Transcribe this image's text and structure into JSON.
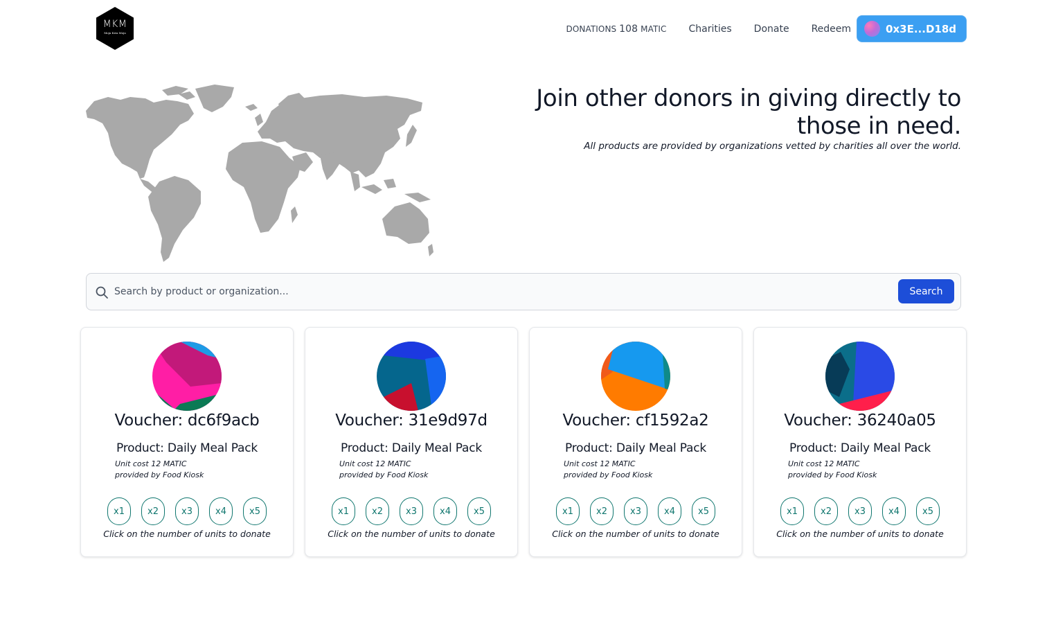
{
  "logo": {
    "letters": "MKM",
    "subtitle": "Moja Kwa Moja"
  },
  "nav": {
    "donations_label": "DONATIONS",
    "donations_value": "108",
    "donations_unit": "MATIC",
    "links": [
      "Charities",
      "Donate",
      "Redeem"
    ],
    "wallet_address": "0x3E...D18d"
  },
  "hero": {
    "title_line1": "Join other donors in giving directly to",
    "title_line2": "those in need.",
    "subtitle": "All products are provided by organizations vetted by charities all over the world."
  },
  "search": {
    "placeholder": "Search by product or organization...",
    "button_label": "Search"
  },
  "cards": [
    {
      "voucher": "Voucher: dc6f9acb",
      "product": "Product: Daily Meal Pack",
      "unit_cost": "Unit cost 12 MATIC",
      "provider": "provided by Food Kiosk",
      "units": [
        "x1",
        "x2",
        "x3",
        "x4",
        "x5"
      ],
      "hint": "Click on the number of units to donate",
      "colors": [
        "#ff1ea5",
        "#c2197a",
        "#1d9be6",
        "#0b7a55"
      ]
    },
    {
      "voucher": "Voucher: 31e9d97d",
      "product": "Product: Daily Meal Pack",
      "unit_cost": "Unit cost 12 MATIC",
      "provider": "provided by Food Kiosk",
      "units": [
        "x1",
        "x2",
        "x3",
        "x4",
        "x5"
      ],
      "hint": "Click on the number of units to donate",
      "colors": [
        "#05668d",
        "#1c39e0",
        "#1565f0",
        "#c8102e"
      ]
    },
    {
      "voucher": "Voucher: cf1592a2",
      "product": "Product: Daily Meal Pack",
      "unit_cost": "Unit cost 12 MATIC",
      "provider": "provided by Food Kiosk",
      "units": [
        "x1",
        "x2",
        "x3",
        "x4",
        "x5"
      ],
      "hint": "Click on the number of units to donate",
      "colors": [
        "#ff7b00",
        "#1699ef",
        "#f05a1a",
        "#0f8a8a"
      ]
    },
    {
      "voucher": "Voucher: 36240a05",
      "product": "Product: Daily Meal Pack",
      "unit_cost": "Unit cost 12 MATIC",
      "provider": "provided by Food Kiosk",
      "units": [
        "x1",
        "x2",
        "x3",
        "x4",
        "x5"
      ],
      "hint": "Click on the number of units to donate",
      "colors": [
        "#0b6e8a",
        "#2a4ae6",
        "#ff1f4b",
        "#073b57"
      ]
    }
  ]
}
